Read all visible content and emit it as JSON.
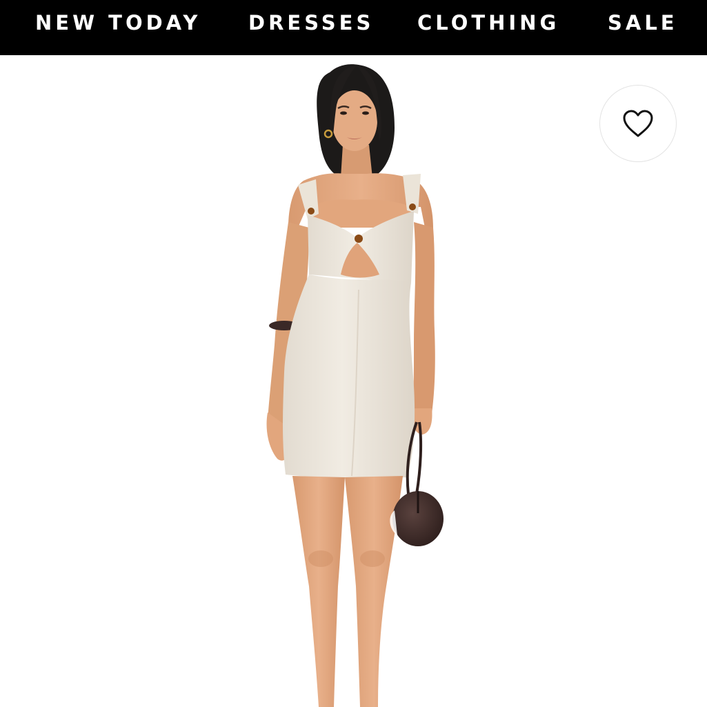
{
  "nav": {
    "items": [
      {
        "label": "NEW TODAY"
      },
      {
        "label": "DRESSES"
      },
      {
        "label": "CLOTHING"
      },
      {
        "label": "SALE"
      }
    ]
  },
  "product": {
    "image_alt": "Model wearing a cream knit mini dress with front cutout and tortoise bead details, holding a round brown bag",
    "colors": {
      "dress": "#ece6dc",
      "skin": "#e2a67d",
      "hair": "#1c1a19",
      "bag": "#3d2a28",
      "bead": "#8a4b17"
    }
  },
  "wishlist": {
    "icon": "heart-outline-icon"
  },
  "theme": {
    "nav_bg": "#000000",
    "nav_text": "#ffffff",
    "page_bg": "#ffffff"
  }
}
